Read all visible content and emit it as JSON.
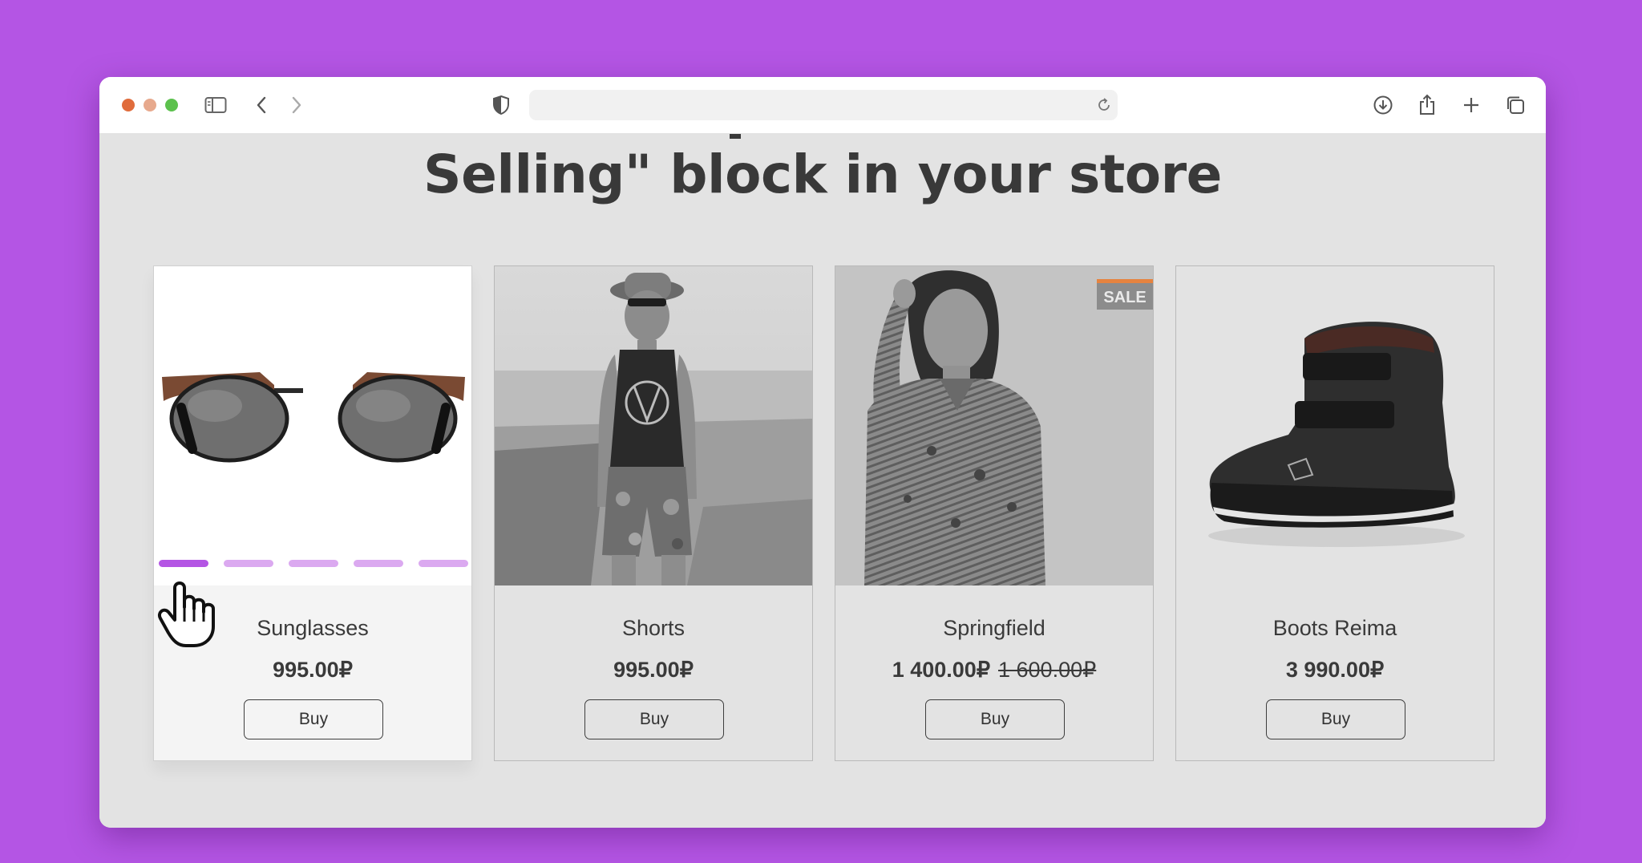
{
  "browser": {
    "address_text": ""
  },
  "page": {
    "heading": "Selling\" block in your store"
  },
  "products": [
    {
      "name": "Sunglasses",
      "price": "995.00₽",
      "old_price": "",
      "buy_label": "Buy",
      "badge": "",
      "active_slide": 1,
      "slide_count": 5
    },
    {
      "name": "Shorts",
      "price": "995.00₽",
      "old_price": "",
      "buy_label": "Buy",
      "badge": ""
    },
    {
      "name": "Springfield",
      "price": "1 400.00₽",
      "old_price": "1 600.00₽",
      "buy_label": "Buy",
      "badge": "SALE"
    },
    {
      "name": "Boots Reima",
      "price": "3 990.00₽",
      "old_price": "",
      "buy_label": "Buy",
      "badge": ""
    }
  ],
  "colors": {
    "page_background": "#b455e4",
    "accent": "#b455e4",
    "sale_stripe": "#e6833f"
  },
  "icons": [
    "sidebar-icon",
    "back-icon",
    "forward-icon",
    "shield-icon",
    "reload-icon",
    "download-icon",
    "share-icon",
    "new-tab-icon",
    "tabs-overview-icon",
    "hand-pointer-icon"
  ]
}
